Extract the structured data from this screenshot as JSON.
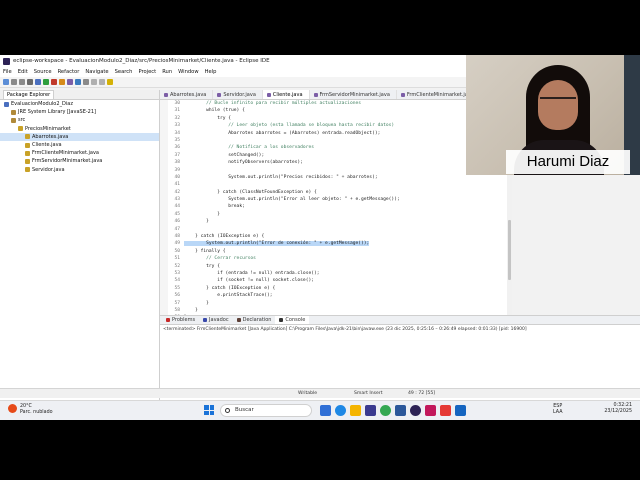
{
  "window": {
    "title": "eclipse-workspace - EvaluacionModulo2_Diaz/src/PreciosMinimarket/Cliente.java - Eclipse IDE",
    "controls": [
      "—",
      "☐",
      "✕"
    ]
  },
  "menu": [
    "File",
    "Edit",
    "Source",
    "Refactor",
    "Navigate",
    "Search",
    "Project",
    "Run",
    "Window",
    "Help"
  ],
  "package_explorer": {
    "title": "Package Explorer",
    "items": [
      {
        "label": "EvaluacionModulo2_Diaz",
        "indent": 0
      },
      {
        "label": "JRE System Library [JavaSE-21]",
        "indent": 1
      },
      {
        "label": "src",
        "indent": 1
      },
      {
        "label": "PreciosMinimarket",
        "indent": 2
      },
      {
        "label": "Abarrotes.java",
        "indent": 3,
        "selected": true
      },
      {
        "label": "Cliente.java",
        "indent": 3
      },
      {
        "label": "FrmClienteMinimarket.java",
        "indent": 3
      },
      {
        "label": "FrmServidorMinimarket.java",
        "indent": 3
      },
      {
        "label": "Servidor.java",
        "indent": 3
      }
    ]
  },
  "editor": {
    "tabs": [
      {
        "label": "Abarrotes.java",
        "active": false
      },
      {
        "label": "Servidor.java",
        "active": false
      },
      {
        "label": "Cliente.java",
        "active": true
      },
      {
        "label": "FrmServidorMinimarket.java",
        "active": false
      },
      {
        "label": "FrmClienteMinimarket.java",
        "active": false
      }
    ],
    "lines": [
      {
        "n": "30",
        "text": "        // Bucle infinito para recibir múltiples actualizaciones",
        "kind": "comment"
      },
      {
        "n": "31",
        "text": "        while (true) {",
        "kind": "code"
      },
      {
        "n": "32",
        "text": "            try {",
        "kind": "code"
      },
      {
        "n": "33",
        "text": "                // Leer objeto (esta llamada se bloquea hasta recibir datos)",
        "kind": "comment"
      },
      {
        "n": "34",
        "text": "                Abarrotes abarrotes = (Abarrotes) entrada.readObject();",
        "kind": "code"
      },
      {
        "n": "35",
        "text": "",
        "kind": "code"
      },
      {
        "n": "36",
        "text": "                // Notificar a los observadores",
        "kind": "comment"
      },
      {
        "n": "37",
        "text": "                setChanged();",
        "kind": "code"
      },
      {
        "n": "38",
        "text": "                notifyObservers(abarrotes);",
        "kind": "code"
      },
      {
        "n": "39",
        "text": "",
        "kind": "code"
      },
      {
        "n": "40",
        "text": "                System.out.println(\"Precios recibidos: \" + abarrotes);",
        "kind": "code"
      },
      {
        "n": "41",
        "text": "",
        "kind": "code"
      },
      {
        "n": "42",
        "text": "            } catch (ClassNotFoundException e) {",
        "kind": "code"
      },
      {
        "n": "43",
        "text": "                System.out.println(\"Error al leer objeto: \" + e.getMessage());",
        "kind": "code"
      },
      {
        "n": "44",
        "text": "                break;",
        "kind": "code"
      },
      {
        "n": "45",
        "text": "            }",
        "kind": "code"
      },
      {
        "n": "46",
        "text": "        }",
        "kind": "code"
      },
      {
        "n": "47",
        "text": "",
        "kind": "code"
      },
      {
        "n": "48",
        "text": "    } catch (IOException e) {",
        "kind": "code"
      },
      {
        "n": "49",
        "text": "        System.out.println(\"Error de conexión: \" + e.getMessage());",
        "kind": "highlight"
      },
      {
        "n": "50",
        "text": "    } finally {",
        "kind": "code"
      },
      {
        "n": "51",
        "text": "        // Cerrar recursos",
        "kind": "comment"
      },
      {
        "n": "52",
        "text": "        try {",
        "kind": "code"
      },
      {
        "n": "53",
        "text": "            if (entrada != null) entrada.close();",
        "kind": "code"
      },
      {
        "n": "54",
        "text": "            if (socket != null) socket.close();",
        "kind": "code"
      },
      {
        "n": "55",
        "text": "        } catch (IOException e) {",
        "kind": "code"
      },
      {
        "n": "56",
        "text": "            e.printStackTrace();",
        "kind": "code"
      },
      {
        "n": "57",
        "text": "        }",
        "kind": "code"
      },
      {
        "n": "58",
        "text": "    }",
        "kind": "code"
      },
      {
        "n": "59",
        "text": "}",
        "kind": "code"
      },
      {
        "n": "60",
        "text": "}",
        "kind": "code"
      }
    ]
  },
  "console": {
    "tabs": [
      {
        "label": "Problems",
        "active": false,
        "color": "#c62828"
      },
      {
        "label": "Javadoc",
        "active": false,
        "color": "#3949ab"
      },
      {
        "label": "Declaration",
        "active": false,
        "color": "#5d4037"
      },
      {
        "label": "Console",
        "active": true,
        "color": "#333333"
      }
    ],
    "output": "<terminated> FrmClienteMinimarket [Java Application] C:\\Program Files\\Java\\jdk-21\\bin\\javaw.exe  (23 dic 2025, 0:25:16 – 0:26:49 elapsed: 0:01:33) [pid: 16900]"
  },
  "statusbar": {
    "mode": "Writable",
    "insert": "Smart Insert",
    "position": "49 : 72 [55]"
  },
  "taskbar": {
    "weather_temp": "20°C",
    "weather_desc": "Parc. nublado",
    "search_placeholder": "Buscar",
    "lang_top": "ESP",
    "lang_bottom": "LAA",
    "time": "0:32:21",
    "date": "23/12/2025"
  },
  "webcam": {
    "name": "Harumi Diaz"
  },
  "colors": {
    "selection": "#b9d7f7",
    "comment": "#3f7f5f",
    "accent": "#1a73d8"
  }
}
